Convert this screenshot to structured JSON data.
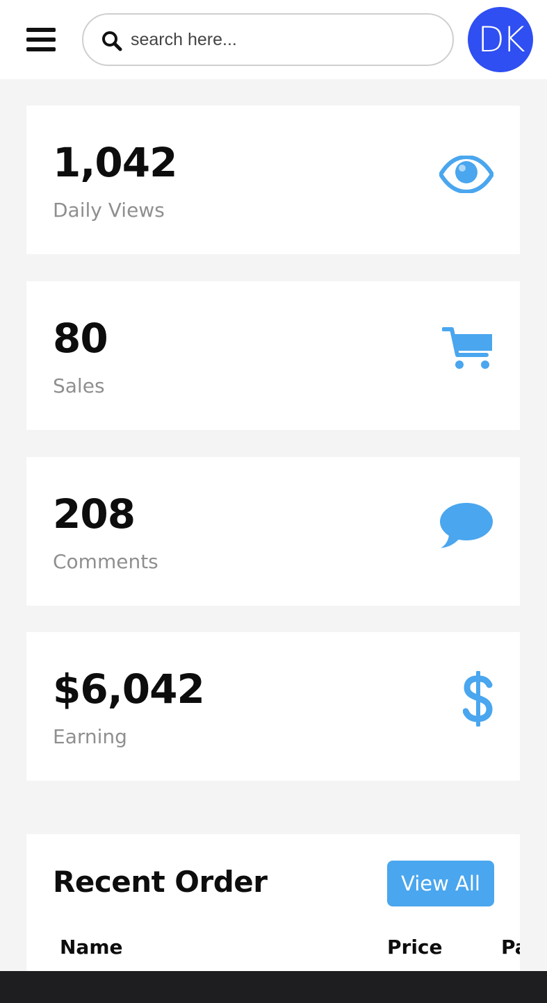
{
  "header": {
    "search_placeholder": "search here...",
    "avatar_initials": "DK",
    "avatar_color": "#2f4ff2"
  },
  "stats": [
    {
      "value": "1,042",
      "label": "Daily Views",
      "icon": "eye-icon"
    },
    {
      "value": "80",
      "label": "Sales",
      "icon": "cart-icon"
    },
    {
      "value": "208",
      "label": "Comments",
      "icon": "comment-icon"
    },
    {
      "value": "$6,042",
      "label": "Earning",
      "icon": "dollar-icon"
    }
  ],
  "accent_color": "#4aa6ee",
  "recent_order": {
    "title": "Recent Order",
    "view_all_label": "View All",
    "columns": [
      "Name",
      "Price",
      "Pa"
    ]
  }
}
